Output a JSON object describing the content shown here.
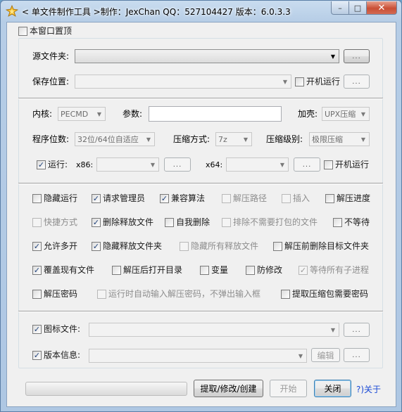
{
  "window": {
    "title": "< 单文件制作工具 >制作：JexChan  QQ：527104427  版本：6.0.3.3",
    "controls": {
      "minimize": "–",
      "maximize": "□",
      "close": "✕"
    }
  },
  "top": {
    "topmost_label": "本窗口置顶",
    "topmost_checked": false
  },
  "source": {
    "source_label": "源文件夹:",
    "source_value": "",
    "browse": "...",
    "save_label": "保存位置:",
    "save_value": "",
    "boot_run_label": "开机运行",
    "boot_run_checked": false,
    "save_browse": "..."
  },
  "options": {
    "kernel_label": "内核:",
    "kernel_value": "PECMD",
    "params_label": "参数:",
    "params_value": "",
    "shell_label": "加壳:",
    "shell_value": "UPX压缩",
    "bits_label": "程序位数:",
    "bits_value": "32位/64位自适应",
    "compress_label": "压缩方式:",
    "compress_value": "7z",
    "level_label": "压缩级别:",
    "level_value": "极限压缩",
    "run_label": "运行:",
    "run_checked": true,
    "x86_label": "x86:",
    "x86_value": "",
    "x86_browse": "...",
    "x64_label": "x64:",
    "x64_value": "",
    "x64_browse": "...",
    "boot_run_label": "开机运行",
    "boot_run_checked": false
  },
  "checks": {
    "hide_run": "隐藏运行",
    "request_admin": "请求管理员",
    "compat": "兼容算法",
    "unzip_path": "解压路径",
    "insert": "插入",
    "unzip_progress": "解压进度",
    "shortcut": "快捷方式",
    "delete_released": "删除释放文件",
    "self_delete": "自我删除",
    "exclude_files": "排除不需要打包的文件",
    "no_wait": "不等待",
    "allow_multi": "允许多开",
    "hide_released_folder": "隐藏释放文件夹",
    "hide_all_released": "隐藏所有释放文件",
    "delete_target_before": "解压前删除目标文件夹",
    "overwrite": "覆盖现有文件",
    "open_dir_after": "解压后打开目录",
    "variables": "变量",
    "anti_modify": "防修改",
    "wait_children": "等待所有子进程",
    "unzip_password": "解压密码",
    "auto_input_password": "运行时自动输入解压密码，不弹出输入框",
    "extract_need_password": "提取压缩包需要密码",
    "check_mark": "✓"
  },
  "resources": {
    "icon_label": "图标文件:",
    "icon_checked": true,
    "icon_value": "",
    "icon_browse": "...",
    "version_label": "版本信息:",
    "version_checked": true,
    "version_value": "",
    "version_edit": "编辑",
    "version_browse": "..."
  },
  "bottom": {
    "progress": 0,
    "extract_button": "提取/修改/创建",
    "start_button": "开始",
    "close_button": "关闭",
    "about_link": "?)关于"
  }
}
